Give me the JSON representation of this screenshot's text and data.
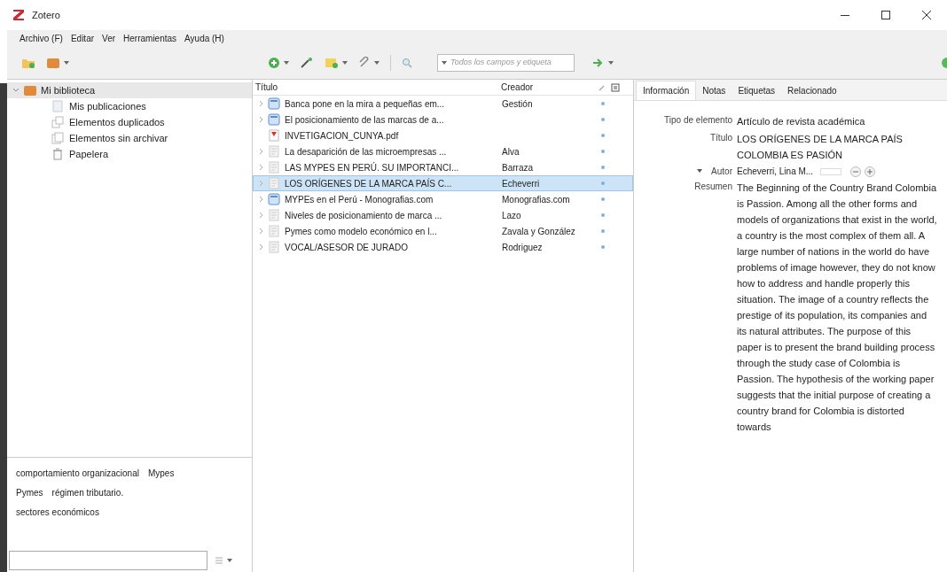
{
  "window": {
    "title": "Zotero"
  },
  "menu": [
    "Archivo (F)",
    "Editar",
    "Ver",
    "Herramientas",
    "Ayuda (H)"
  ],
  "search": {
    "placeholder": "Todos los campos y etiqueta"
  },
  "library": {
    "label": "Mi biblioteca",
    "expanded": true,
    "selected": true,
    "children": [
      {
        "label": "Mis publicaciones",
        "kind": "publications"
      },
      {
        "label": "Elementos duplicados",
        "kind": "duplicates"
      },
      {
        "label": "Elementos sin archivar",
        "kind": "unfiled"
      },
      {
        "label": "Papelera",
        "kind": "trash"
      }
    ]
  },
  "tags": [
    [
      "comportamiento organizacional",
      "Mypes"
    ],
    [
      "Pymes",
      "régimen tributario."
    ],
    [
      "sectores económicos"
    ]
  ],
  "table": {
    "columns": [
      "Título",
      "Creador"
    ],
    "rows": [
      {
        "title": "Banca pone en la mira a pequeñas em...",
        "creator": "Gestión",
        "kind": "webpage",
        "expandable": true,
        "selected": false
      },
      {
        "title": "El posicionamiento de las marcas de a...",
        "creator": "",
        "kind": "webpage",
        "expandable": true,
        "selected": false
      },
      {
        "title": "INVETIGACION_CUNYA.pdf",
        "creator": "",
        "kind": "pdf",
        "expandable": false,
        "selected": false
      },
      {
        "title": "La desaparición de las microempresas ...",
        "creator": "Alva",
        "kind": "document",
        "expandable": true,
        "selected": false
      },
      {
        "title": "LAS MYPES EN PERÚ. SU IMPORTANCI...",
        "creator": "Barraza",
        "kind": "document",
        "expandable": true,
        "selected": false
      },
      {
        "title": "LOS ORÍGENES DE LA MARCA PAÍS C...",
        "creator": "Echeverri",
        "kind": "document",
        "expandable": true,
        "selected": true
      },
      {
        "title": "MYPEs en el Perú - Monografias.com",
        "creator": "Monografias.com",
        "kind": "webpage",
        "expandable": true,
        "selected": false
      },
      {
        "title": "Niveles de posicionamiento de marca ...",
        "creator": "Lazo",
        "kind": "document",
        "expandable": true,
        "selected": false
      },
      {
        "title": "Pymes como modelo económico en l...",
        "creator": "Zavala y González",
        "kind": "document",
        "expandable": true,
        "selected": false
      },
      {
        "title": "VOCAL/ASESOR DE JURADO",
        "creator": "Rodriguez",
        "kind": "document",
        "expandable": true,
        "selected": false
      }
    ]
  },
  "tabs": [
    {
      "label": "Información",
      "selected": true
    },
    {
      "label": "Notas",
      "selected": false
    },
    {
      "label": "Etiquetas",
      "selected": false
    },
    {
      "label": "Relacionado",
      "selected": false
    }
  ],
  "info": [
    {
      "label": "Tipo de elemento",
      "value": "Artículo de revista académica",
      "kind": "text"
    },
    {
      "label": "Título",
      "value": "LOS ORÍGENES DE LA MARCA PAÍS COLOMBIA ES PASIÓN",
      "kind": "text"
    },
    {
      "label": "Autor",
      "value": "Echeverri, Lina M...",
      "kind": "creator"
    },
    {
      "label": "Resumen",
      "value": "The Beginning of the Country Brand Colombia is Passion. Among all the other forms and models of organizations that exist in the world, a country is the most complex of them all. A large number of nations in the world do have problems of image however, they do not know how to address and handle properly this situation. The image of a country reflects the prestige of its population, its companies and its natural attributes. The purpose of this paper is to present the brand building process through the study case of Colombia is Passion. The hypothesis of the working paper suggests that the initial purpose of creating a country brand for Colombia is distorted towards",
      "kind": "text"
    }
  ]
}
